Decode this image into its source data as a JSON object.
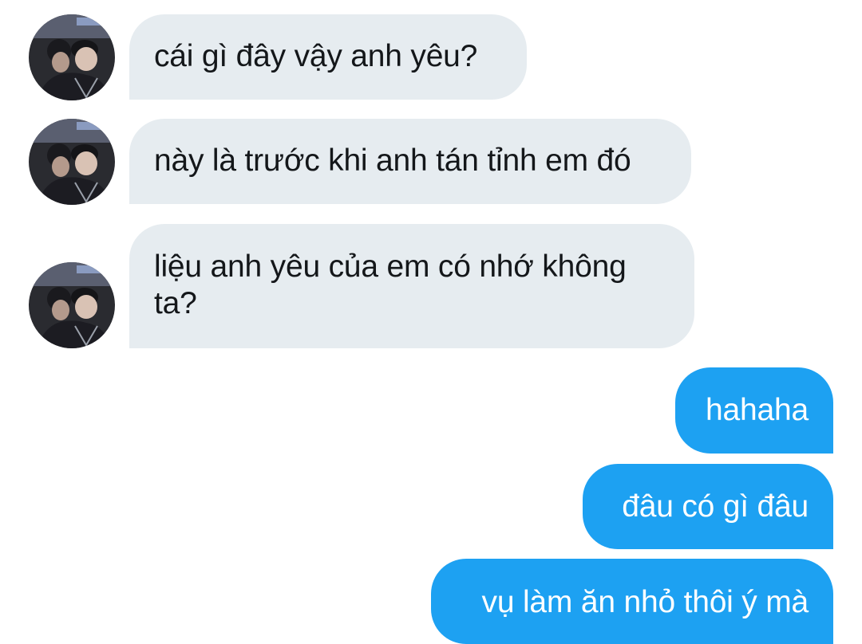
{
  "thread": {
    "incoming": [
      {
        "text": "cái gì đây vậy anh yêu?",
        "avatar_icon": "contact-avatar-photo"
      },
      {
        "text": "này là trước khi anh tán tỉnh em đó",
        "avatar_icon": "contact-avatar-photo"
      },
      {
        "text": "liệu anh yêu của em có nhớ không\nta?",
        "avatar_icon": "contact-avatar-photo"
      }
    ],
    "outgoing": [
      {
        "text": "hahaha"
      },
      {
        "text": "đâu có gì đâu"
      },
      {
        "text": "vụ làm ăn nhỏ thôi ý mà"
      }
    ]
  },
  "colors": {
    "incoming_bubble": "#e6ecf0",
    "incoming_text": "#14171a",
    "outgoing_bubble": "#1da1f2",
    "outgoing_text": "#ffffff",
    "background": "#ffffff"
  }
}
